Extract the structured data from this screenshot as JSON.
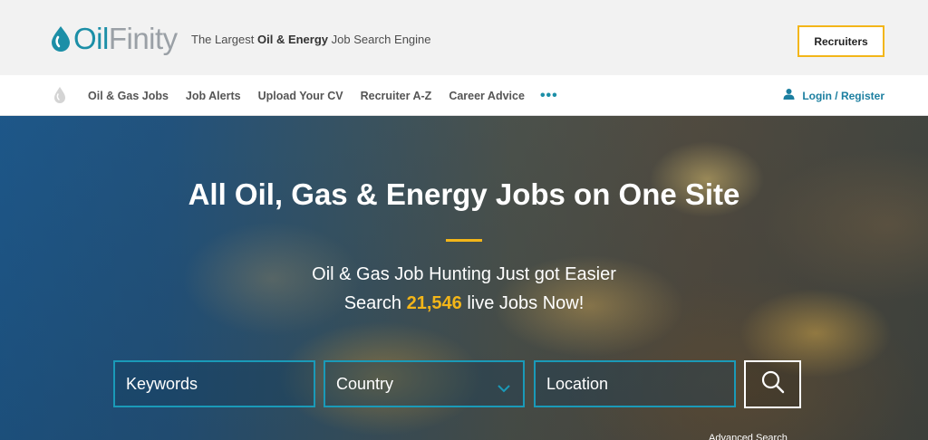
{
  "header": {
    "logo_text_colored": "Oil",
    "logo_text_gray": "Finity",
    "tagline_pre": "The Largest ",
    "tagline_bold": "Oil & Energy",
    "tagline_post": " Job Search Engine",
    "recruiters_label": "Recruiters"
  },
  "nav": {
    "items": [
      {
        "label": "Oil & Gas Jobs"
      },
      {
        "label": "Job Alerts"
      },
      {
        "label": "Upload Your CV"
      },
      {
        "label": "Recruiter A-Z"
      },
      {
        "label": "Career Advice"
      }
    ],
    "more_label": "•••",
    "login_label": "Login / Register"
  },
  "hero": {
    "headline": "All Oil, Gas & Energy Jobs on One Site",
    "subline": "Oil & Gas Job Hunting Just got Easier",
    "search_pre": "Search ",
    "job_count": "21,546",
    "search_post": " live Jobs Now!"
  },
  "search": {
    "keywords_placeholder": "Keywords",
    "country_value": "Country",
    "location_placeholder": "Location",
    "advanced_label": "Advanced Search"
  },
  "colors": {
    "brand_teal": "#1c8fa7",
    "accent_yellow": "#f3b619",
    "field_border": "#1a9ab8"
  },
  "icons": {
    "logo": "water-drop-icon",
    "nav_logo": "water-drop-icon",
    "login": "user-icon",
    "country": "chevron-down-icon",
    "search": "search-icon"
  }
}
